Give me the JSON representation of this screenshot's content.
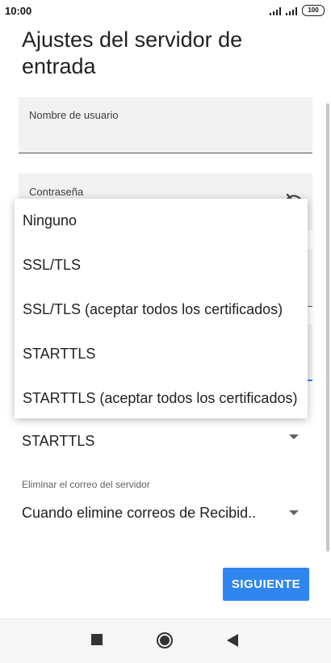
{
  "status_bar": {
    "time": "10:00",
    "battery": "100"
  },
  "page": {
    "title": "Ajustes del servidor de entrada"
  },
  "form": {
    "username_label": "Nombre de usuario",
    "username_value": "",
    "password_label": "Contraseña",
    "security_value": "STARTTLS",
    "delete_label": "Eliminar el correo del servidor",
    "delete_value": "Cuando elimine correos de Recibid.."
  },
  "dropdown": {
    "options": [
      "Ninguno",
      "SSL/TLS",
      "SSL/TLS (aceptar todos los certificados)",
      "STARTTLS",
      "STARTTLS (aceptar todos los certificados)"
    ]
  },
  "actions": {
    "next_label": "SIGUIENTE"
  },
  "icons": {
    "eye": "visibility-off-icon",
    "caret": "dropdown-arrow-icon",
    "nav_recents": "square-icon",
    "nav_home": "circle-icon",
    "nav_back": "triangle-back-icon"
  },
  "colors": {
    "accent": "#2f86f0",
    "field_bg": "#f1f1f1"
  }
}
